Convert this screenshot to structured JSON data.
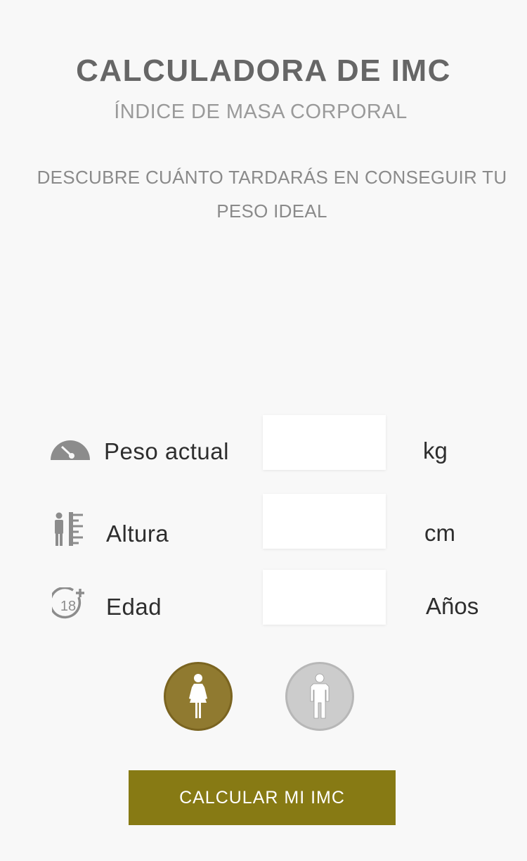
{
  "header": {
    "title": "CALCULADORA DE IMC",
    "subtitle": "ÍNDICE DE MASA CORPORAL",
    "description": "DESCUBRE CUÁNTO TARDARÁS EN CONSEGUIR TU PESO IDEAL"
  },
  "form": {
    "weight": {
      "label": "Peso actual",
      "value": "",
      "unit": "kg",
      "icon": "speedometer-icon"
    },
    "height": {
      "label": "Altura",
      "value": "",
      "unit": "cm",
      "icon": "height-ruler-icon"
    },
    "age": {
      "label": "Edad",
      "value": "",
      "unit": "Años",
      "icon": "age-18-plus-icon"
    },
    "gender": {
      "options": [
        {
          "id": "female",
          "icon": "female-icon",
          "selected": true
        },
        {
          "id": "male",
          "icon": "male-icon",
          "selected": false
        }
      ]
    },
    "submit_label": "CALCULAR MI IMC"
  },
  "colors": {
    "background": "#f8f8f8",
    "accent_button": "#877a14",
    "selected_gender": "#907a30",
    "unselected_gender": "#cccccc",
    "icon_gray": "#8c8c8c"
  }
}
